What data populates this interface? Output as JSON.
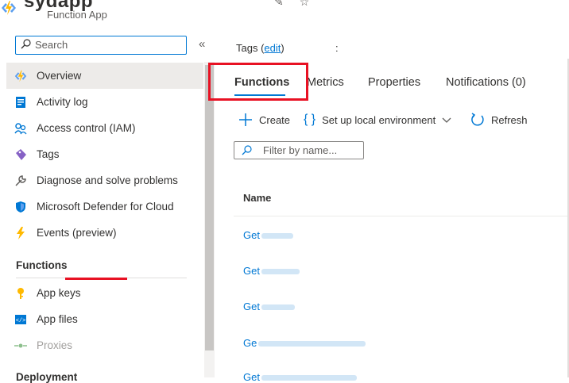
{
  "header": {
    "app_name": "sydapp",
    "app_type": "Function App",
    "pin_icon": "pin-icon",
    "favorite_icon": "star-icon"
  },
  "sidebar": {
    "search_placeholder": "Search",
    "collapse_label": "«",
    "items": [
      {
        "label": "Overview",
        "icon": "lightning-icon",
        "active": true
      },
      {
        "label": "Activity log",
        "icon": "log-icon"
      },
      {
        "label": "Access control (IAM)",
        "icon": "people-icon"
      },
      {
        "label": "Tags",
        "icon": "tag-icon"
      },
      {
        "label": "Diagnose and solve problems",
        "icon": "wrench-icon"
      },
      {
        "label": "Microsoft Defender for Cloud",
        "icon": "shield-icon"
      },
      {
        "label": "Events (preview)",
        "icon": "lightning-icon"
      }
    ],
    "section_functions": "Functions",
    "functions_items": [
      {
        "label": "App keys",
        "icon": "key-icon"
      },
      {
        "label": "App files",
        "icon": "code-file-icon"
      },
      {
        "label": "Proxies",
        "icon": "proxy-icon",
        "disabled": true
      }
    ],
    "section_deployment": "Deployment"
  },
  "main": {
    "tags_label": "Tags (",
    "tags_edit": "edit",
    "tags_close": ")",
    "tags_colon": ":",
    "tabs": [
      {
        "label": "Functions"
      },
      {
        "label": "Metrics"
      },
      {
        "label": "Properties"
      },
      {
        "label": "Notifications (0)"
      }
    ],
    "toolbar": {
      "create": "Create",
      "local_env": "Set up local environment",
      "refresh": "Refresh"
    },
    "filter_placeholder": "Filter by name...",
    "table": {
      "column_name": "Name",
      "rows": [
        "Get",
        "Get",
        "Get",
        "Ge",
        "Get"
      ]
    }
  },
  "colors": {
    "accent": "#0078d4",
    "highlight": "#e81123"
  }
}
